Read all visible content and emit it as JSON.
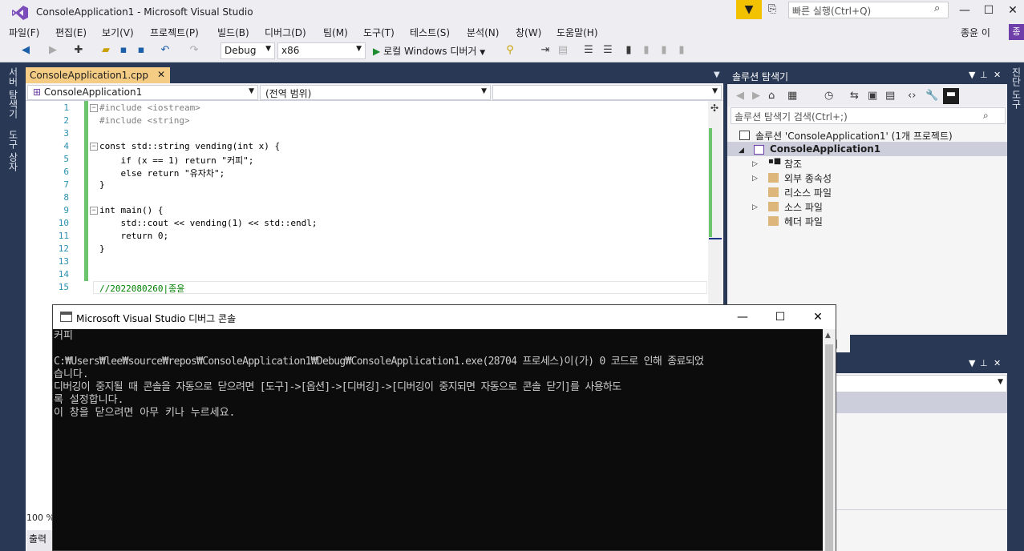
{
  "window": {
    "title": "ConsoleApplication1 - Microsoft Visual Studio",
    "quick_launch_placeholder": "빠른 실행(Ctrl+Q)",
    "minimize": "—",
    "maximize": "☐",
    "close": "✕"
  },
  "menu": {
    "items": [
      "파일(F)",
      "편집(E)",
      "보기(V)",
      "프로젝트(P)",
      "빌드(B)",
      "디버그(D)",
      "팀(M)",
      "도구(T)",
      "테스트(S)",
      "분석(N)",
      "창(W)",
      "도움말(H)"
    ],
    "user": "종윤 이",
    "user_badge": "종이"
  },
  "toolbar": {
    "config": "Debug",
    "platform": "x86",
    "run_label": "로컬 Windows 디버거"
  },
  "left_tabs": [
    "서버 탐색기",
    "도구 상자"
  ],
  "right_tabs": [
    "진단 도구"
  ],
  "editor": {
    "tab_label": "ConsoleApplication1.cpp",
    "nav_project": "ConsoleApplication1",
    "nav_scope": "(전역 범위)",
    "zoom": "100 %",
    "output_tab": "출력",
    "lines": [
      {
        "n": "1",
        "text": "#include <iostream>"
      },
      {
        "n": "2",
        "text": "#include <string>"
      },
      {
        "n": "3",
        "text": ""
      },
      {
        "n": "4",
        "text": "const std::string vending(int x) {"
      },
      {
        "n": "5",
        "text": "    if (x == 1) return \"커피\";"
      },
      {
        "n": "6",
        "text": "    else return \"유자차\";"
      },
      {
        "n": "7",
        "text": "}"
      },
      {
        "n": "8",
        "text": ""
      },
      {
        "n": "9",
        "text": "int main() {"
      },
      {
        "n": "10",
        "text": "    std::cout << vending(1) << std::endl;"
      },
      {
        "n": "11",
        "text": "    return 0;"
      },
      {
        "n": "12",
        "text": "}"
      },
      {
        "n": "13",
        "text": ""
      },
      {
        "n": "14",
        "text": ""
      },
      {
        "n": "15",
        "text": "//2022080260|종윤"
      }
    ]
  },
  "solution_explorer": {
    "title": "솔루션 탐색기",
    "search_placeholder": "솔루션 탐색기 검색(Ctrl+;)",
    "solution": "솔루션 'ConsoleApplication1' (1개 프로젝트)",
    "project": "ConsoleApplication1",
    "nodes": [
      "참조",
      "외부 종속성",
      "리소스 파일",
      "소스 파일",
      "헤더 파일"
    ]
  },
  "panel2": {
    "tab_fragment": "기"
  },
  "console": {
    "title": "Microsoft Visual Studio 디버그 콘솔",
    "lines": [
      "커피",
      "",
      "C:₩Users₩lee₩source₩repos₩ConsoleApplication1₩Debug₩ConsoleApplication1.exe(28704 프로세스)이(가) 0 코드로 인해 종료되었",
      "습니다.",
      "디버깅이 중지될 때 콘솔을 자동으로 닫으려면 [도구]->[옵션]->[디버깅]->[디버깅이 중지되면 자동으로 콘솔 닫기]를 사용하도",
      "록 설정합니다.",
      "이 창을 닫으려면 아무 키나 누르세요."
    ]
  }
}
